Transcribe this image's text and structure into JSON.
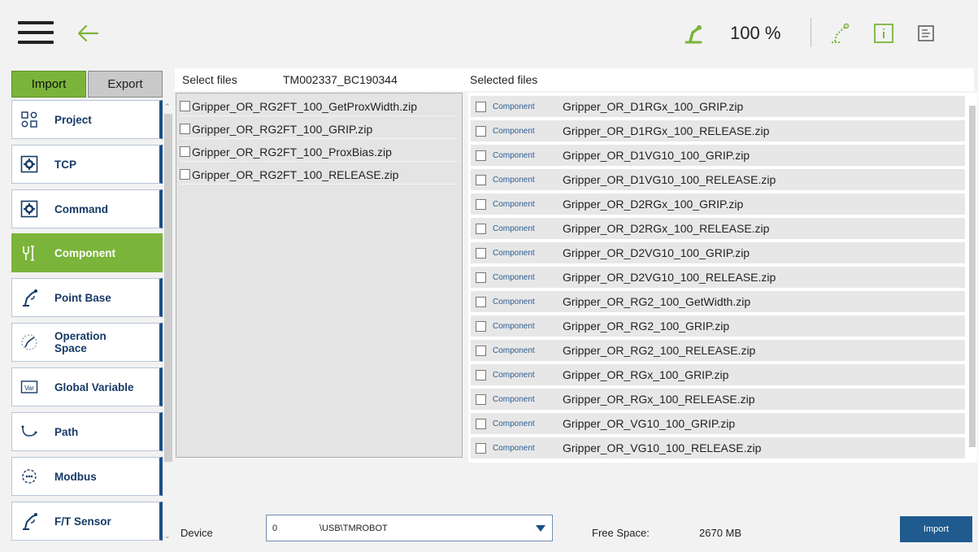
{
  "topbar": {
    "menu_icon": "hamburger-menu-icon",
    "back_icon": "back-arrow-icon",
    "speed_value": "100 %",
    "accent_color": "#7bb43a",
    "brand_color": "#1c4f86"
  },
  "tabs": {
    "import": "Import",
    "export": "Export"
  },
  "sidebar": {
    "items": [
      {
        "label": "Project",
        "icon": "project-icon",
        "active": false
      },
      {
        "label": "TCP",
        "icon": "tcp-gear-icon",
        "active": false
      },
      {
        "label": "Command",
        "icon": "command-gear-icon",
        "active": false
      },
      {
        "label": "Component",
        "icon": "component-icon",
        "active": true
      },
      {
        "label": "Point Base",
        "icon": "point-base-icon",
        "active": false
      },
      {
        "label": "Operation\nSpace",
        "icon": "operation-space-icon",
        "active": false
      },
      {
        "label": "Global Variable",
        "icon": "var-icon",
        "active": false
      },
      {
        "label": "Path",
        "icon": "path-icon",
        "active": false
      },
      {
        "label": "Modbus",
        "icon": "modbus-icon",
        "active": false
      },
      {
        "label": "F/T Sensor",
        "icon": "ft-sensor-icon",
        "active": false
      }
    ]
  },
  "select_files": {
    "label": "Select files",
    "serial": "TM002337_BC190344",
    "files": [
      "Gripper_OR_RG2FT_100_GetProxWidth.zip",
      "Gripper_OR_RG2FT_100_GRIP.zip",
      "Gripper_OR_RG2FT_100_ProxBias.zip",
      "Gripper_OR_RG2FT_100_RELEASE.zip"
    ]
  },
  "selected_files": {
    "label": "Selected files",
    "rows": [
      {
        "type": "Component",
        "name": "Gripper_OR_D1RGx_100_GRIP.zip"
      },
      {
        "type": "Component",
        "name": "Gripper_OR_D1RGx_100_RELEASE.zip"
      },
      {
        "type": "Component",
        "name": "Gripper_OR_D1VG10_100_GRIP.zip"
      },
      {
        "type": "Component",
        "name": "Gripper_OR_D1VG10_100_RELEASE.zip"
      },
      {
        "type": "Component",
        "name": "Gripper_OR_D2RGx_100_GRIP.zip"
      },
      {
        "type": "Component",
        "name": "Gripper_OR_D2RGx_100_RELEASE.zip"
      },
      {
        "type": "Component",
        "name": "Gripper_OR_D2VG10_100_GRIP.zip"
      },
      {
        "type": "Component",
        "name": "Gripper_OR_D2VG10_100_RELEASE.zip"
      },
      {
        "type": "Component",
        "name": "Gripper_OR_RG2_100_GetWidth.zip"
      },
      {
        "type": "Component",
        "name": "Gripper_OR_RG2_100_GRIP.zip"
      },
      {
        "type": "Component",
        "name": "Gripper_OR_RG2_100_RELEASE.zip"
      },
      {
        "type": "Component",
        "name": "Gripper_OR_RGx_100_GRIP.zip"
      },
      {
        "type": "Component",
        "name": "Gripper_OR_RGx_100_RELEASE.zip"
      },
      {
        "type": "Component",
        "name": "Gripper_OR_VG10_100_GRIP.zip"
      },
      {
        "type": "Component",
        "name": "Gripper_OR_VG10_100_RELEASE.zip"
      }
    ]
  },
  "device": {
    "label": "Device",
    "number": "0",
    "path": "\\USB\\TMROBOT"
  },
  "free_space": {
    "label": "Free Space:",
    "value": "2670 MB"
  },
  "import_button": "Import"
}
